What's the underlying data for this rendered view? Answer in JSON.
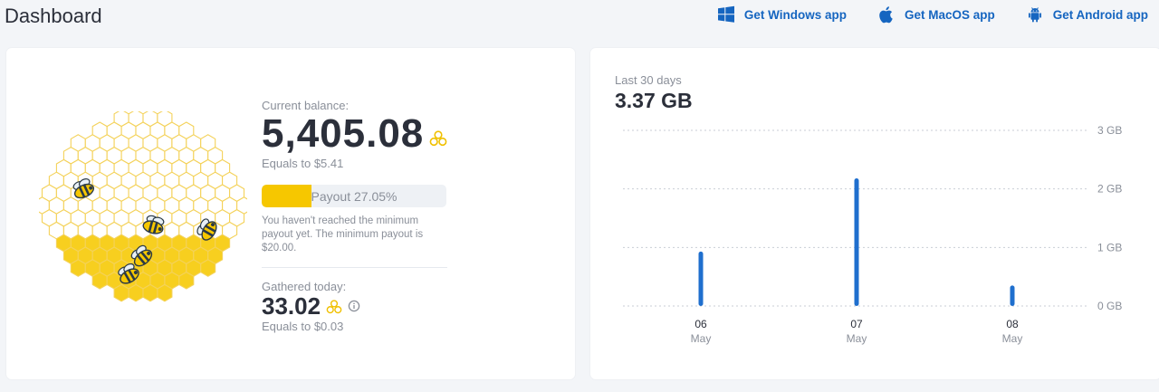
{
  "header": {
    "title": "Dashboard",
    "apps": [
      {
        "label": "Get Windows app",
        "icon": "windows-icon"
      },
      {
        "label": "Get MacOS app",
        "icon": "apple-icon"
      },
      {
        "label": "Get Android app",
        "icon": "android-icon"
      }
    ]
  },
  "balance": {
    "current_label": "Current balance:",
    "current_value": "5,405.08",
    "current_equals": "Equals to $5.41",
    "payout_label": "Payout 27.05%",
    "payout_fraction": 0.2705,
    "note": "You haven't reached the minimum payout yet. The minimum payout is $20.00.",
    "gathered_label": "Gathered today:",
    "gathered_value": "33.02",
    "gathered_equals": "Equals to $0.03"
  },
  "colors": {
    "accent_blue": "#1565c0",
    "honey_yellow": "#f6c700",
    "bar_blue": "#1f6fce"
  },
  "chart_data": {
    "type": "bar",
    "title": "3.37 GB",
    "subtitle": "Last 30 days",
    "categories": [
      "06 May",
      "07 May",
      "08 May"
    ],
    "category_day": [
      "06",
      "07",
      "08"
    ],
    "category_month": [
      "May",
      "May",
      "May"
    ],
    "values": [
      0.93,
      2.18,
      0.35
    ],
    "unit": "GB",
    "yticks": [
      "0 GB",
      "1 GB",
      "2 GB",
      "3 GB"
    ],
    "ylim": [
      0,
      3
    ],
    "grid": true
  }
}
